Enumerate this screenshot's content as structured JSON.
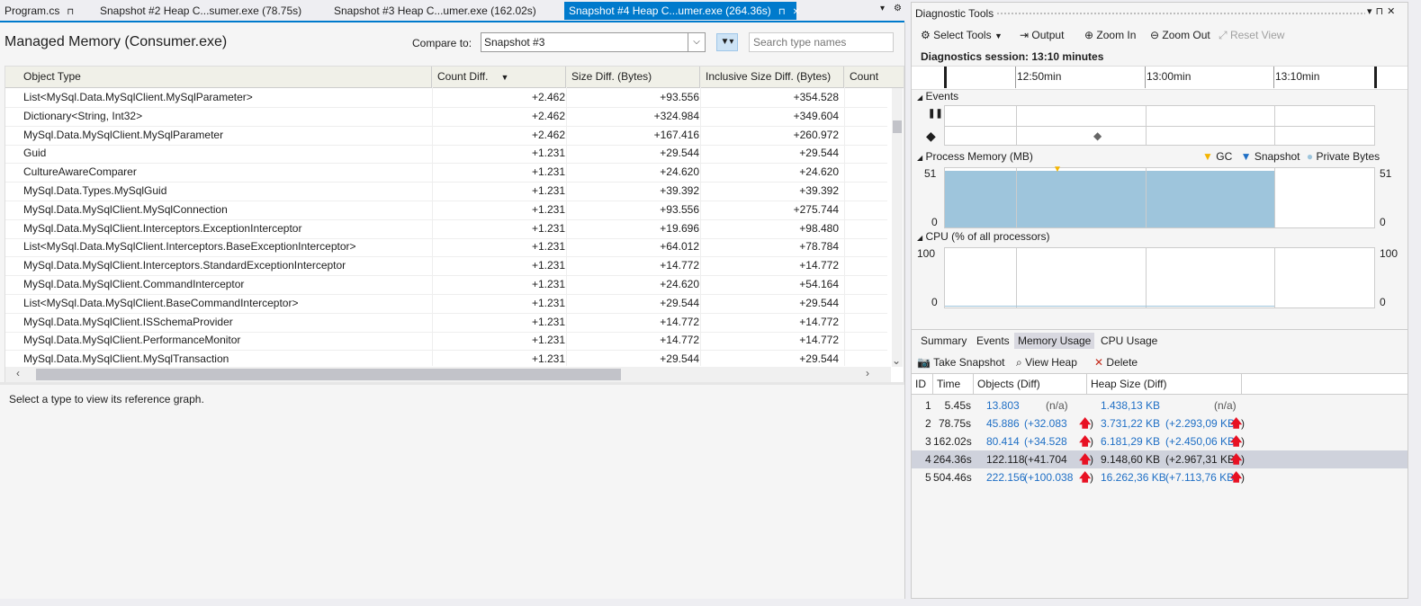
{
  "tabs": [
    {
      "label": "Program.cs",
      "pin": "⊓"
    },
    {
      "label": "Snapshot #2 Heap C...sumer.exe (78.75s)"
    },
    {
      "label": "Snapshot #3 Heap C...umer.exe (162.02s)"
    },
    {
      "label": "Snapshot #4 Heap C...umer.exe (264.36s)",
      "pin": "⊓",
      "close": "✕"
    }
  ],
  "left": {
    "title": "Managed Memory (Consumer.exe)",
    "compare_label": "Compare to:",
    "compare_value": "Snapshot #3",
    "search_placeholder": "Search type names",
    "ref_message": "Select a type to view its reference graph.",
    "columns": [
      "Object Type",
      "Count Diff.",
      "Size Diff. (Bytes)",
      "Inclusive Size Diff. (Bytes)",
      "Count"
    ],
    "sort_indicator": "▼",
    "rows": [
      {
        "type": "List<MySql.Data.MySqlClient.MySqlParameter>",
        "count": "+2.462",
        "size": "+93.556",
        "incl": "+354.528"
      },
      {
        "type": "Dictionary<String, Int32>",
        "count": "+2.462",
        "size": "+324.984",
        "incl": "+349.604"
      },
      {
        "type": "MySql.Data.MySqlClient.MySqlParameter",
        "count": "+2.462",
        "size": "+167.416",
        "incl": "+260.972"
      },
      {
        "type": "Guid",
        "count": "+1.231",
        "size": "+29.544",
        "incl": "+29.544"
      },
      {
        "type": "CultureAwareComparer",
        "count": "+1.231",
        "size": "+24.620",
        "incl": "+24.620"
      },
      {
        "type": "MySql.Data.Types.MySqlGuid",
        "count": "+1.231",
        "size": "+39.392",
        "incl": "+39.392"
      },
      {
        "type": "MySql.Data.MySqlClient.MySqlConnection",
        "count": "+1.231",
        "size": "+93.556",
        "incl": "+275.744"
      },
      {
        "type": "MySql.Data.MySqlClient.Interceptors.ExceptionInterceptor",
        "count": "+1.231",
        "size": "+19.696",
        "incl": "+98.480"
      },
      {
        "type": "List<MySql.Data.MySqlClient.Interceptors.BaseExceptionInterceptor>",
        "count": "+1.231",
        "size": "+64.012",
        "incl": "+78.784"
      },
      {
        "type": "MySql.Data.MySqlClient.Interceptors.StandardExceptionInterceptor",
        "count": "+1.231",
        "size": "+14.772",
        "incl": "+14.772"
      },
      {
        "type": "MySql.Data.MySqlClient.CommandInterceptor",
        "count": "+1.231",
        "size": "+24.620",
        "incl": "+54.164"
      },
      {
        "type": "List<MySql.Data.MySqlClient.BaseCommandInterceptor>",
        "count": "+1.231",
        "size": "+29.544",
        "incl": "+29.544"
      },
      {
        "type": "MySql.Data.MySqlClient.ISSchemaProvider",
        "count": "+1.231",
        "size": "+14.772",
        "incl": "+14.772"
      },
      {
        "type": "MySql.Data.MySqlClient.PerformanceMonitor",
        "count": "+1.231",
        "size": "+14.772",
        "incl": "+14.772"
      },
      {
        "type": "MySql.Data.MySqlClient.MySqlTransaction",
        "count": "+1.231",
        "size": "+29.544",
        "incl": "+29.544"
      }
    ]
  },
  "right": {
    "title": "Diagnostic Tools",
    "toolbar": {
      "select_tools": "Select Tools",
      "output": "Output",
      "zoom_in": "Zoom In",
      "zoom_out": "Zoom Out",
      "reset_view": "Reset View"
    },
    "session": "Diagnostics session: 13:10 minutes",
    "ruler_labels": [
      "12:50min",
      "13:00min",
      "13:10min"
    ],
    "events_label": "Events",
    "memory_label": "Process Memory (MB)",
    "memory_legend": {
      "gc": "GC",
      "snapshot": "Snapshot",
      "private": "Private Bytes"
    },
    "memory_axis": {
      "max": "51",
      "min": "0"
    },
    "memory_level_fraction": 0.96,
    "cpu_label": "CPU (% of all processors)",
    "cpu_axis": {
      "max": "100",
      "min": "0"
    },
    "summary_tabs": [
      "Summary",
      "Events",
      "Memory Usage",
      "CPU Usage"
    ],
    "summary_active": "Memory Usage",
    "summary_toolbar": {
      "take_snapshot": "Take Snapshot",
      "view_heap": "View Heap",
      "delete": "Delete"
    },
    "snap_columns": [
      "ID",
      "Time",
      "Objects (Diff)",
      "Heap Size (Diff)"
    ],
    "snapshots": [
      {
        "id": "1",
        "time": "5.45s",
        "objects": "13.803",
        "obj_diff": "(n/a)",
        "heap": "1.438,13 KB",
        "heap_diff": "(n/a)",
        "up": false
      },
      {
        "id": "2",
        "time": "78.75s",
        "objects": "45.886",
        "obj_diff": "(+32.083",
        "heap": "3.731,22 KB",
        "heap_diff": "(+2.293,09 KB",
        "up": true
      },
      {
        "id": "3",
        "time": "162.02s",
        "objects": "80.414",
        "obj_diff": "(+34.528",
        "heap": "6.181,29 KB",
        "heap_diff": "(+2.450,06 KB",
        "up": true
      },
      {
        "id": "4",
        "time": "264.36s",
        "objects": "122.118",
        "obj_diff": "(+41.704",
        "heap": "9.148,60 KB",
        "heap_diff": "(+2.967,31 KB",
        "up": true
      },
      {
        "id": "5",
        "time": "504.46s",
        "objects": "222.156",
        "obj_diff": "(+100.038",
        "heap": "16.262,36 KB",
        "heap_diff": "(+7.113,76 KB",
        "up": true
      }
    ],
    "selected_snapshot": "4"
  },
  "colors": {
    "accent": "#007acc",
    "memory_fill": "#9ec5dc",
    "gc_marker": "#f4b400",
    "snapshot_marker": "#1f6fc5",
    "arrow_up": "#e81123"
  }
}
